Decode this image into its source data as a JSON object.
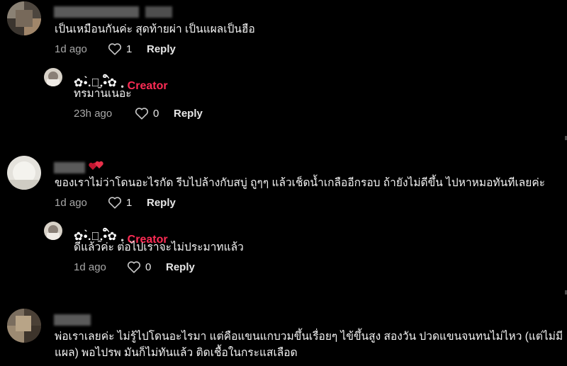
{
  "colors": {
    "background": "#000000",
    "creator_badge": "#fe2c55",
    "meta_text": "#a8a8a8"
  },
  "comments": [
    {
      "text": "เป็นเหมือนกันค่ะ สุดท้ายผ่า เป็นแผลเป็นฮือ",
      "time": "1d ago",
      "likes": "1",
      "reply_label": "Reply",
      "reply": {
        "handle": "✿•̀.ི̫.ི•́✿",
        "badge": "Creator",
        "text": "ทรมานเนอะ",
        "time": "23h ago",
        "likes": "0",
        "reply_label": "Reply"
      }
    },
    {
      "text": "ของเราไม่ว่าโดนอะไรกัด รีบไปล้างกับสบู่ ถูๆๆ แล้วเช็ดน้ำเกลืออีกรอบ ถ้ายังไม่ดีขึ้น ไปหาหมอทันทีเลยค่ะ",
      "time": "1d ago",
      "likes": "1",
      "reply_label": "Reply",
      "reply": {
        "handle": "✿•̀.ི̫.ི•́✿",
        "badge": "Creator",
        "text": "ดีแล้วค่ะ ต่อไปเราจะไม่ประมาทแล้ว",
        "time": "1d ago",
        "likes": "0",
        "reply_label": "Reply"
      }
    },
    {
      "text_line1": "พ่อเราเลยค่ะ ไม่รู้ไปโดนอะไรมา แต่คือแขนแกบวมขึ้นเรื่อยๆ ไข้ขึ้นสูง สองวัน ปวดแขนจนทนไม่ไหว (แต่ไม่มี",
      "text_line2": "แผล) พอไปรพ มันก็ไม่ทันแล้ว ติดเชื้อในกระแสเลือด"
    }
  ],
  "icons": {
    "like": "heart-outline-icon",
    "emoji": "red-hearts-icon"
  }
}
